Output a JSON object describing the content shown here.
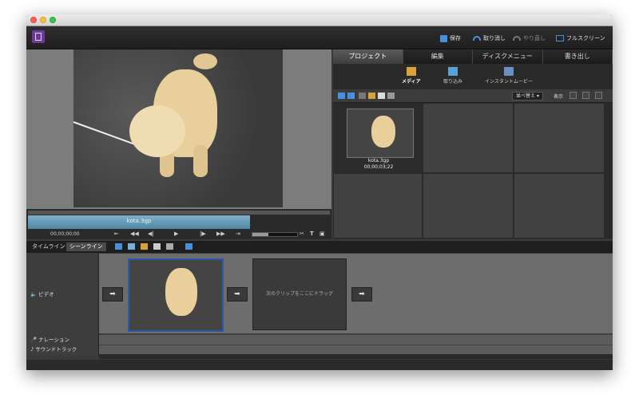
{
  "toolbar": {
    "save": "保存",
    "undo": "取り消し",
    "redo": "やり直し",
    "fullscreen": "フルスクリーン"
  },
  "monitor": {
    "clip_name": "kota.3gp",
    "timecode": "00;00;00;00"
  },
  "panel": {
    "tabs": [
      "プロジェクト",
      "編集",
      "ディスクメニュー",
      "書き出し"
    ],
    "sub_items": [
      "メディア",
      "取り込み",
      "インスタントムービー"
    ],
    "sort_label": "並べ替え",
    "show_label": "表示",
    "media": {
      "name": "kota.3gp",
      "duration": "00;00;03;22"
    }
  },
  "lower": {
    "tabs": [
      "タイムライン",
      "シーンライン"
    ],
    "tracks": {
      "video": "ビデオ",
      "narration": "ナレーション",
      "soundtrack": "サウンドトラック"
    },
    "drop_hint": "次のクリップをここにドラッグ"
  },
  "colors": {
    "accent": "#4a90d9",
    "clip_blue": "#4f87a3",
    "selected_clip_border": "#2a5aa6"
  }
}
